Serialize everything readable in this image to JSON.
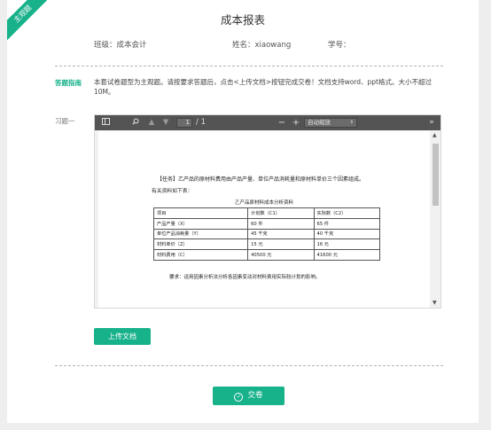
{
  "badge": "主观题",
  "title": "成本报表",
  "info": {
    "class_label": "班级：成本会计",
    "name_label": "姓名：xiaowang",
    "id_label": "学号："
  },
  "guide": {
    "label": "答题指南",
    "text": "本套试卷题型为主观题。请按要求答题后，点击<上传文档>按钮完成交卷！文档支持word、ppt格式。大小不超过10M。"
  },
  "question_label": "习题一",
  "viewer": {
    "toolbar": {
      "page_current": "1",
      "page_total": "/ 1",
      "zoom": "自动缩放",
      "icons": [
        "sidebar-toggle-icon",
        "search-icon",
        "page-up-icon",
        "page-down-icon",
        "zoom-out-icon",
        "zoom-in-icon",
        "more-tools-icon"
      ]
    },
    "document": {
      "task": "【任务】乙产品的原材料费用由产品产量、单位产品消耗量和原材料单价三个因素组成。",
      "intro": "有关资料如下表：",
      "table_title": "乙产品原材料成本分析资料",
      "table": {
        "headers": [
          "项目",
          "计划数（C1）",
          "实际数（C2）"
        ],
        "rows": [
          [
            "产品产量（X）",
            "60 件",
            "65 件"
          ],
          [
            "单位产品消耗量（Y）",
            "45 千克",
            "40 千克"
          ],
          [
            "材料单价（Z）",
            "15 元",
            "16 元"
          ],
          [
            "材料费用（C）",
            "40500 元",
            "41600 元"
          ]
        ]
      },
      "requirement": "要求：运用因素分析法分析各因素变动对材料费用实际较计划的影响。"
    }
  },
  "upload_label": "上传文档",
  "submit_label": "交卷",
  "colors": {
    "accent": "#17b18a",
    "toolbar": "#545454",
    "background": "#eeeeee"
  }
}
